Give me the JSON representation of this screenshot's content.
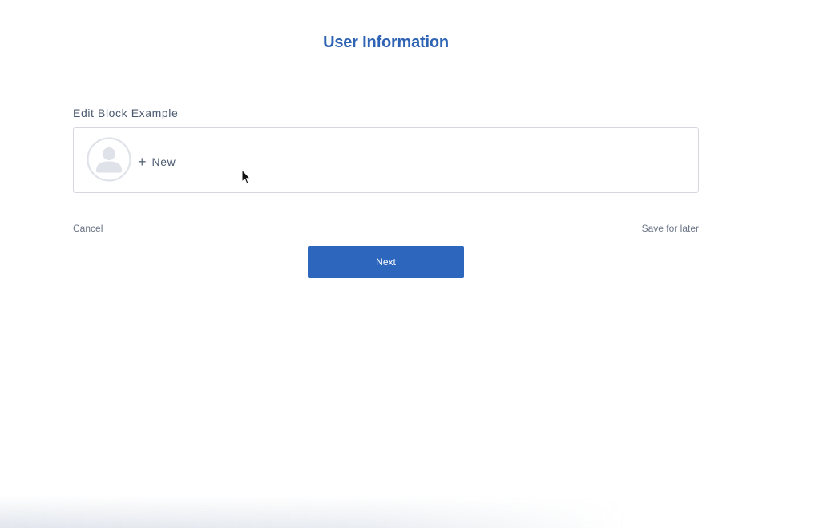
{
  "page": {
    "title": "User Information"
  },
  "edit_block": {
    "label": "Edit Block Example",
    "avatar_icon": "user-avatar-icon",
    "add_icon": "plus-icon",
    "add_label": "New"
  },
  "footer": {
    "cancel_label": "Cancel",
    "save_later_label": "Save for later",
    "next_label": "Next"
  },
  "colors": {
    "accent": "#2f63b3",
    "button": "#2d66bd",
    "border": "#d5d9df",
    "avatar": "#dfe2e8"
  }
}
